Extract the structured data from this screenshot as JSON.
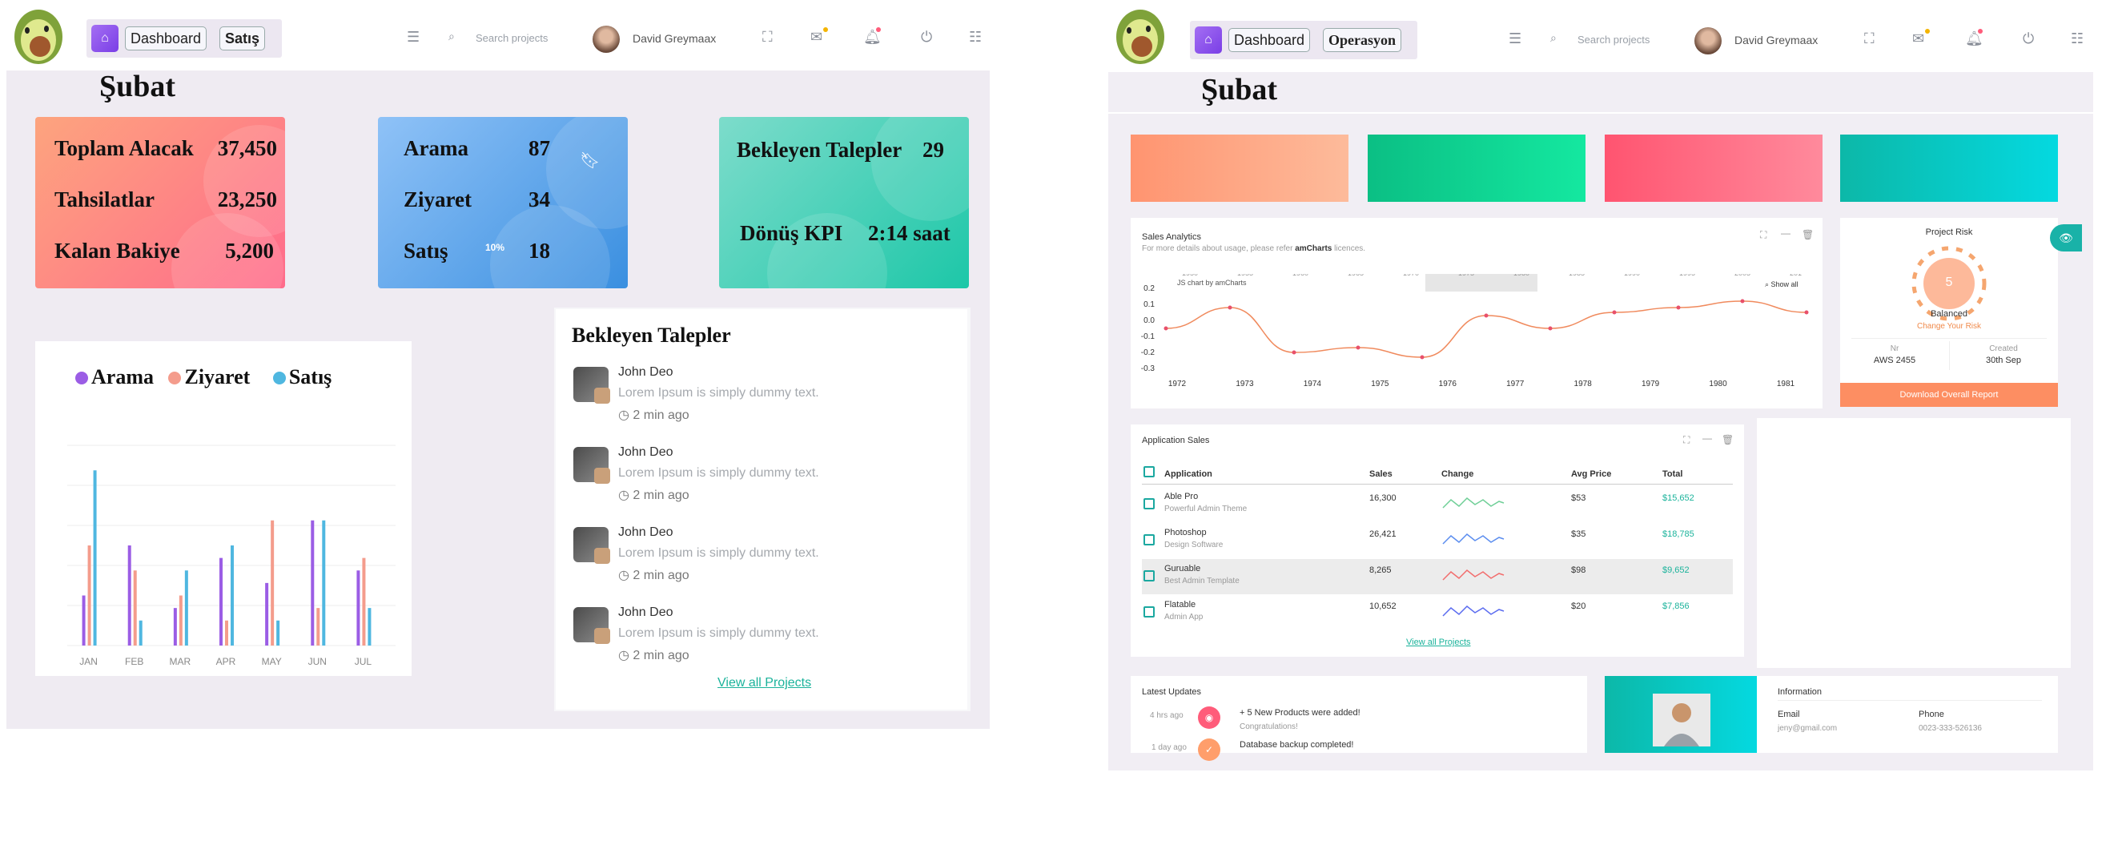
{
  "left": {
    "topbar": {
      "crumb_dashboard": "Dashboard",
      "crumb_current": "Satış",
      "search_placeholder": "Search projects",
      "user_name": "David Greymaax"
    },
    "month_title": "Şubat",
    "card1": {
      "rows": [
        {
          "label": "Toplam Alacak",
          "value": "37,450"
        },
        {
          "label": "Tahsilatlar",
          "value": "23,250"
        },
        {
          "label": "Kalan Bakiye",
          "value": "5,200"
        }
      ]
    },
    "card2": {
      "rows": [
        {
          "label": "Arama",
          "value": "87"
        },
        {
          "label": "Ziyaret",
          "value": "34"
        },
        {
          "label": "Satış",
          "value": "18"
        }
      ],
      "badge": "10%"
    },
    "card3": {
      "rows": [
        {
          "label": "Bekleyen Talepler",
          "value": "29"
        },
        {
          "label": "Dönüş KPI",
          "value": "2:14 saat"
        }
      ]
    },
    "bar_chart": {
      "legend": [
        {
          "name": "Arama",
          "color": "#9b5de5"
        },
        {
          "name": "Ziyaret",
          "color": "#f49c8c"
        },
        {
          "name": "Satış",
          "color": "#4fb7e0"
        }
      ]
    },
    "pending": {
      "title": "Bekleyen Talepler",
      "items": [
        {
          "name": "John Deo",
          "text": "Lorem Ipsum is simply dummy text.",
          "time": "2 min ago"
        },
        {
          "name": "John Deo",
          "text": "Lorem Ipsum is simply dummy text.",
          "time": "2 min ago"
        },
        {
          "name": "John Deo",
          "text": "Lorem Ipsum is simply dummy text.",
          "time": "2 min ago"
        },
        {
          "name": "John Deo",
          "text": "Lorem Ipsum is simply dummy text.",
          "time": "2 min ago"
        }
      ],
      "link": "View all Projects"
    }
  },
  "right": {
    "topbar": {
      "crumb_dashboard": "Dashboard",
      "crumb_current": "Operasyon",
      "search_placeholder": "Search projects",
      "user_name": "David Greymaax"
    },
    "month_title": "Şubat",
    "sales_analytics": {
      "title": "Sales Analytics",
      "subtitle_pre": "For more details about usage, please refer",
      "subtitle_link": "amCharts",
      "subtitle_post": "licences.",
      "credit": "JS chart by amCharts",
      "show_all": "Show all",
      "scrollbar_years": [
        "1950",
        "1955",
        "1960",
        "1965",
        "1970",
        "1975",
        "1980",
        "1985",
        "1990",
        "1995",
        "2005",
        "201"
      ]
    },
    "project_risk": {
      "title": "Project Risk",
      "value": "5",
      "status": "Balanced",
      "link": "Change Your Risk",
      "left_label": "Nr",
      "left_value": "AWS 2455",
      "right_label": "Created",
      "right_value": "30th Sep",
      "button": "Download Overall Report"
    },
    "app_sales": {
      "title": "Application Sales",
      "columns": [
        "Application",
        "Sales",
        "Change",
        "Avg Price",
        "Total"
      ],
      "rows": [
        {
          "name": "Able Pro",
          "sub": "Powerful Admin Theme",
          "sales": "16,300",
          "avg": "$53",
          "total": "$15,652",
          "spark": "#6fcf97"
        },
        {
          "name": "Photoshop",
          "sub": "Design Software",
          "sales": "26,421",
          "avg": "$35",
          "total": "$18,785",
          "spark": "#5b8def"
        },
        {
          "name": "Guruable",
          "sub": "Best Admin Template",
          "sales": "8,265",
          "avg": "$98",
          "total": "$9,652",
          "spark": "#f26d6d"
        },
        {
          "name": "Flatable",
          "sub": "Admin App",
          "sales": "10,652",
          "avg": "$20",
          "total": "$7,856",
          "spark": "#5b6cf0"
        }
      ],
      "link": "View all Projects"
    },
    "latest_updates": {
      "title": "Latest Updates",
      "items": [
        {
          "time": "4 hrs ago",
          "text": "+ 5 New Products were added!",
          "sub": "Congratulations!"
        },
        {
          "time": "1 day ago",
          "text": "Database backup completed!",
          "sub": ""
        }
      ]
    },
    "information": {
      "title": "Information",
      "email_label": "Email",
      "email_value": "jeny@gmail.com",
      "phone_label": "Phone",
      "phone_value": "0023-333-526136"
    }
  },
  "chart_data": [
    {
      "type": "bar",
      "categories": [
        "JAN",
        "FEB",
        "MAR",
        "APR",
        "MAY",
        "JUN",
        "JUL"
      ],
      "series": [
        {
          "name": "Arama",
          "values": [
            20,
            40,
            15,
            35,
            25,
            50,
            30
          ]
        },
        {
          "name": "Ziyaret",
          "values": [
            40,
            30,
            20,
            10,
            50,
            15,
            35
          ]
        },
        {
          "name": "Satış",
          "values": [
            70,
            10,
            30,
            40,
            10,
            50,
            15
          ]
        }
      ],
      "ylim": [
        0,
        80
      ]
    },
    {
      "type": "line",
      "title": "Sales Analytics",
      "x": [
        "1972",
        "1973",
        "1974",
        "1975",
        "1976",
        "1977",
        "1978",
        "1979",
        "1980",
        "1981"
      ],
      "values": [
        -0.05,
        0.08,
        -0.2,
        -0.17,
        -0.23,
        0.03,
        -0.05,
        0.05,
        0.08,
        0.12,
        0.05
      ],
      "ylim": [
        -0.3,
        0.2
      ],
      "yticks": [
        "0.2",
        "0.1",
        "0.0",
        "-0.1",
        "-0.2",
        "-0.3"
      ]
    }
  ]
}
